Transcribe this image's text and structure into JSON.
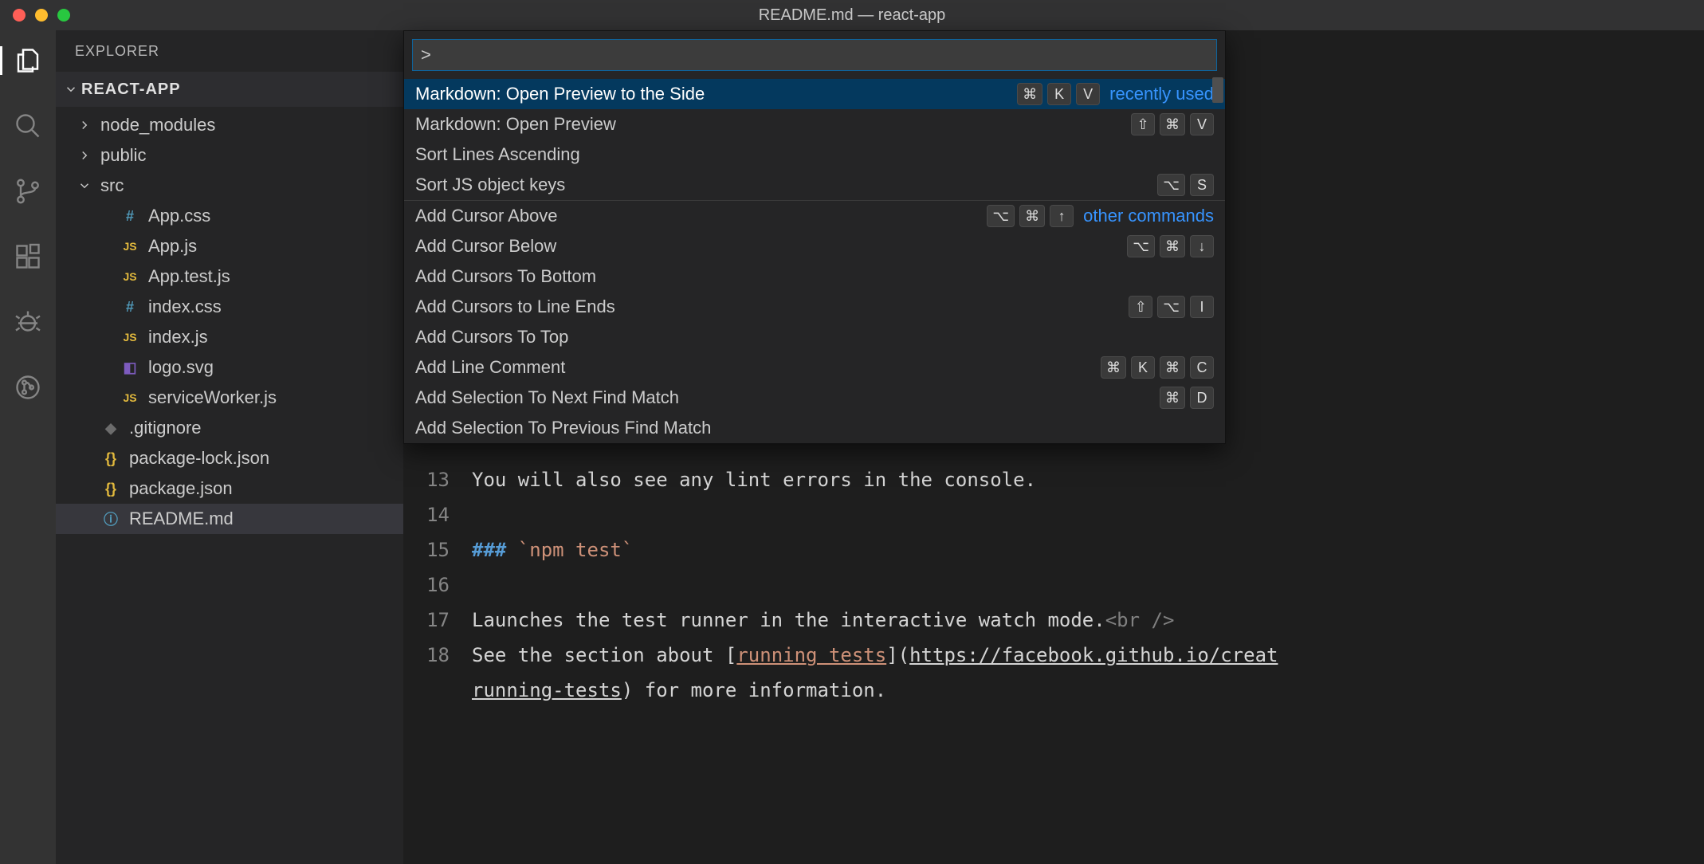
{
  "titlebar": {
    "title": "README.md — react-app"
  },
  "sidebar": {
    "header": "EXPLORER",
    "project": "REACT-APP",
    "tree": [
      {
        "kind": "folder",
        "name": "node_modules",
        "expanded": false,
        "depth": 1
      },
      {
        "kind": "folder",
        "name": "public",
        "expanded": false,
        "depth": 1
      },
      {
        "kind": "folder",
        "name": "src",
        "expanded": true,
        "depth": 1
      },
      {
        "kind": "file",
        "name": "App.css",
        "icon": "css",
        "glyph": "#",
        "depth": 2
      },
      {
        "kind": "file",
        "name": "App.js",
        "icon": "js",
        "glyph": "JS",
        "depth": 2
      },
      {
        "kind": "file",
        "name": "App.test.js",
        "icon": "js",
        "glyph": "JS",
        "depth": 2
      },
      {
        "kind": "file",
        "name": "index.css",
        "icon": "css",
        "glyph": "#",
        "depth": 2
      },
      {
        "kind": "file",
        "name": "index.js",
        "icon": "js",
        "glyph": "JS",
        "depth": 2
      },
      {
        "kind": "file",
        "name": "logo.svg",
        "icon": "svg",
        "glyph": "◧",
        "depth": 2
      },
      {
        "kind": "file",
        "name": "serviceWorker.js",
        "icon": "js",
        "glyph": "JS",
        "depth": 2
      },
      {
        "kind": "file",
        "name": ".gitignore",
        "icon": "git",
        "glyph": "◆",
        "depth": 1
      },
      {
        "kind": "file",
        "name": "package-lock.json",
        "icon": "json",
        "glyph": "{}",
        "depth": 1
      },
      {
        "kind": "file",
        "name": "package.json",
        "icon": "json",
        "glyph": "{}",
        "depth": 1
      },
      {
        "kind": "file",
        "name": "README.md",
        "icon": "info",
        "glyph": "ⓘ",
        "depth": 1,
        "selected": true
      }
    ]
  },
  "palette": {
    "input_value": ">",
    "groups": [
      {
        "meta": "recently used",
        "items": [
          {
            "label": "Markdown: Open Preview to the Side",
            "keys": [
              "⌘",
              "K",
              "V"
            ],
            "selected": true
          },
          {
            "label": "Markdown: Open Preview",
            "keys": [
              "⇧",
              "⌘",
              "V"
            ]
          },
          {
            "label": "Sort Lines Ascending",
            "keys": []
          },
          {
            "label": "Sort JS object keys",
            "keys": [
              "⌥",
              "S"
            ]
          }
        ]
      },
      {
        "meta": "other commands",
        "items": [
          {
            "label": "Add Cursor Above",
            "keys": [
              "⌥",
              "⌘",
              "↑"
            ]
          },
          {
            "label": "Add Cursor Below",
            "keys": [
              "⌥",
              "⌘",
              "↓"
            ]
          },
          {
            "label": "Add Cursors To Bottom",
            "keys": []
          },
          {
            "label": "Add Cursors to Line Ends",
            "keys": [
              "⇧",
              "⌥",
              "I"
            ]
          },
          {
            "label": "Add Cursors To Top",
            "keys": []
          },
          {
            "label": "Add Line Comment",
            "keys": [
              "⌘",
              "K",
              "⌘",
              "C"
            ]
          },
          {
            "label": "Add Selection To Next Find Match",
            "keys": [
              "⌘",
              "D"
            ]
          },
          {
            "label": "Add Selection To Previous Find Match",
            "keys": []
          }
        ]
      }
    ]
  },
  "editor": {
    "lines": [
      {
        "num": 13,
        "text": "You will also see any lint errors in the console."
      },
      {
        "num": 14,
        "text": ""
      },
      {
        "num": 15,
        "html": "<span class='md-heading'>### </span><span class='md-code'>`npm test`</span>"
      },
      {
        "num": 16,
        "text": ""
      },
      {
        "num": 17,
        "html": "Launches the test runner in the interactive watch mode.<span class='md-tag'>&lt;br /&gt;</span>"
      },
      {
        "num": 18,
        "html": "See the section about [<span class='md-linktext'>running tests</span>](<span class='md-linkurl'>https://facebook.github.io/creat</span>"
      },
      {
        "num": null,
        "html": "<span class='md-linkurl'>running-tests</span>) for more information."
      }
    ]
  }
}
